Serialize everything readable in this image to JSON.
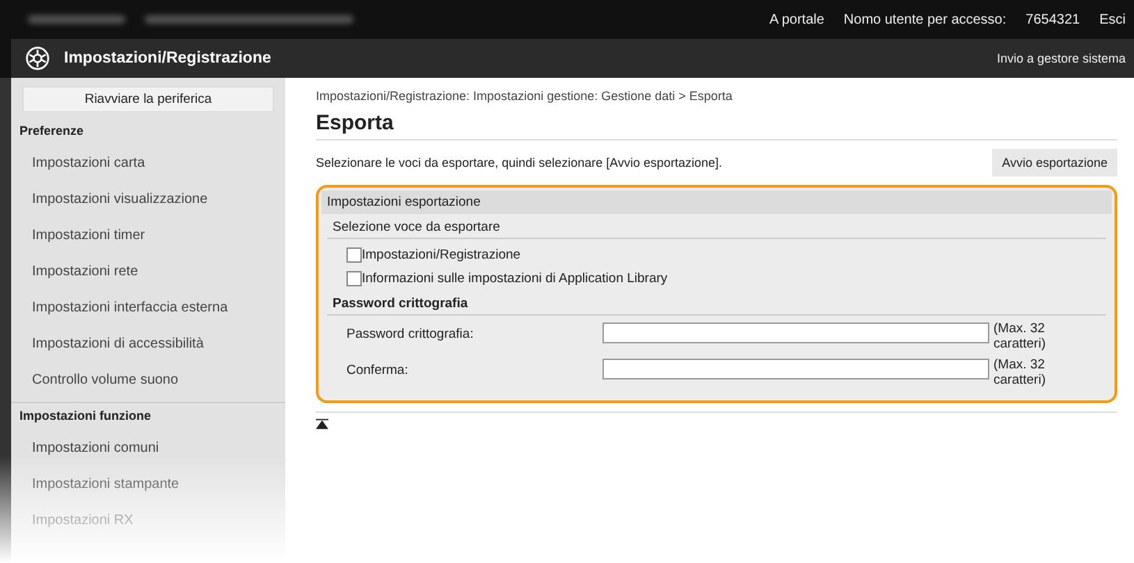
{
  "top_bar": {
    "links": [
      "A portale",
      "Nomo utente per accesso:",
      "7654321",
      "Esci"
    ]
  },
  "header": {
    "title": "Impostazioni/Registrazione",
    "link": "Invio a gestore sistema"
  },
  "sidebar": {
    "restart_button": "Riavviare la periferica",
    "sections": [
      {
        "title": "Preferenze",
        "items": [
          "Impostazioni carta",
          "Impostazioni visualizzazione",
          "Impostazioni timer",
          "Impostazioni rete",
          "Impostazioni interfaccia esterna",
          "Impostazioni di accessibilità",
          "Controllo volume suono"
        ]
      },
      {
        "title": "Impostazioni funzione",
        "items": [
          "Impostazioni comuni",
          "Impostazioni stampante",
          "Impostazioni RX"
        ]
      }
    ]
  },
  "breadcrumb": "Impostazioni/Registrazione: Impostazioni gestione: Gestione dati > Esporta",
  "page_title": "Esporta",
  "instruction": "Selezionare le voci da esportare, quindi selezionare [Avvio esportazione].",
  "start_button": "Avvio esportazione",
  "panel": {
    "title": "Impostazioni esportazione",
    "highlighted": true,
    "select_section": {
      "title": "Selezione voce da esportare",
      "items": [
        {
          "label": "Impostazioni/Registrazione",
          "checked": false
        },
        {
          "label": "Informazioni sulle impostazioni di Application Library",
          "checked": false
        }
      ]
    },
    "password_section": {
      "title": "Password crittografia",
      "fields": [
        {
          "label": "Password crittografia:",
          "note": "(Max. 32 caratteri)"
        },
        {
          "label": "Conferma:",
          "note": "(Max. 32 caratteri)"
        }
      ]
    }
  }
}
